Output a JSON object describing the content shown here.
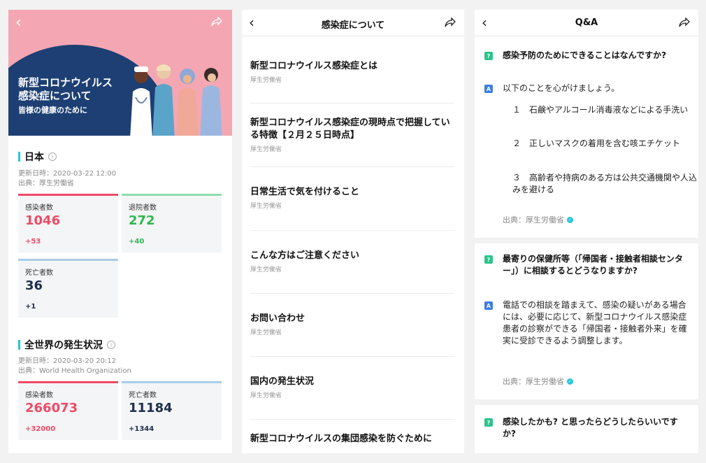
{
  "panel1": {
    "banner": {
      "title_line1": "新型コロナウイルス",
      "title_line2": "感染症について",
      "subtitle": "皆様の健康のために"
    },
    "japan": {
      "heading": "日本",
      "updated": "更新日時：2020-03-22 12:00",
      "source": "出典：厚生労働省",
      "cards": [
        {
          "label": "感染者数",
          "value": "1046",
          "delta": "+53",
          "color": "#ef4a66"
        },
        {
          "label": "退院者数",
          "value": "272",
          "delta": "+40",
          "color": "#2db84d"
        },
        {
          "label": "死亡者数",
          "value": "36",
          "delta": "+1",
          "color": "#1f2d4d"
        }
      ]
    },
    "world": {
      "heading": "全世界の発生状況",
      "updated": "更新日時：2020-03-20 20:12",
      "source": "出典：World Health Organization",
      "cards": [
        {
          "label": "感染者数",
          "value": "266073",
          "delta": "+32000",
          "color": "#ef4a66"
        },
        {
          "label": "死亡者数",
          "value": "11184",
          "delta": "+1344",
          "color": "#1f2d4d"
        }
      ]
    }
  },
  "panel2": {
    "title": "感染症について",
    "items": [
      {
        "title": "新型コロナウイルス感染症とは",
        "source": "厚生労働省"
      },
      {
        "title": "新型コロナウイルス感染症の現時点で把握している特徴【２月２５日時点】",
        "source": "厚生労働省"
      },
      {
        "title": "日常生活で気を付けること",
        "source": "厚生労働省"
      },
      {
        "title": "こんな方はご注意ください",
        "source": "厚生労働省"
      },
      {
        "title": "お問い合わせ",
        "source": "厚生労働省"
      },
      {
        "title": "国内の発生状況",
        "source": "厚生労働省"
      },
      {
        "title": "新型コロナウイルスの集団感染を防ぐために",
        "source": ""
      }
    ]
  },
  "panel3": {
    "title": "Q&A",
    "q_badge": "?",
    "a_badge": "A",
    "qa": [
      {
        "question": "感染予防のためにできることはなんですか?",
        "answer_intro": "以下のことを心がけましょう。",
        "points": [
          "１　石鹸やアルコール消毒液などによる手洗い",
          "２　正しいマスクの着用を含む咳エチケット",
          "３　高齢者や持病のある方は公共交通機関や人込みを避ける"
        ],
        "source": "出典：厚生労働省"
      },
      {
        "question": "最寄りの保健所等（「帰国者・接触者相談センター」）に相談するとどうなりますか?",
        "answer": "電話での相談を踏まえて、感染の疑いがある場合には、必要に応じて、新型コロナウイルス感染症患者の診察ができる「帰国者・接触者外来」を確実に受診できるよう調整します。",
        "source": "出典：厚生労働省"
      },
      {
        "question": "感染したかも? と思ったらどうしたらいいですか?"
      }
    ]
  }
}
